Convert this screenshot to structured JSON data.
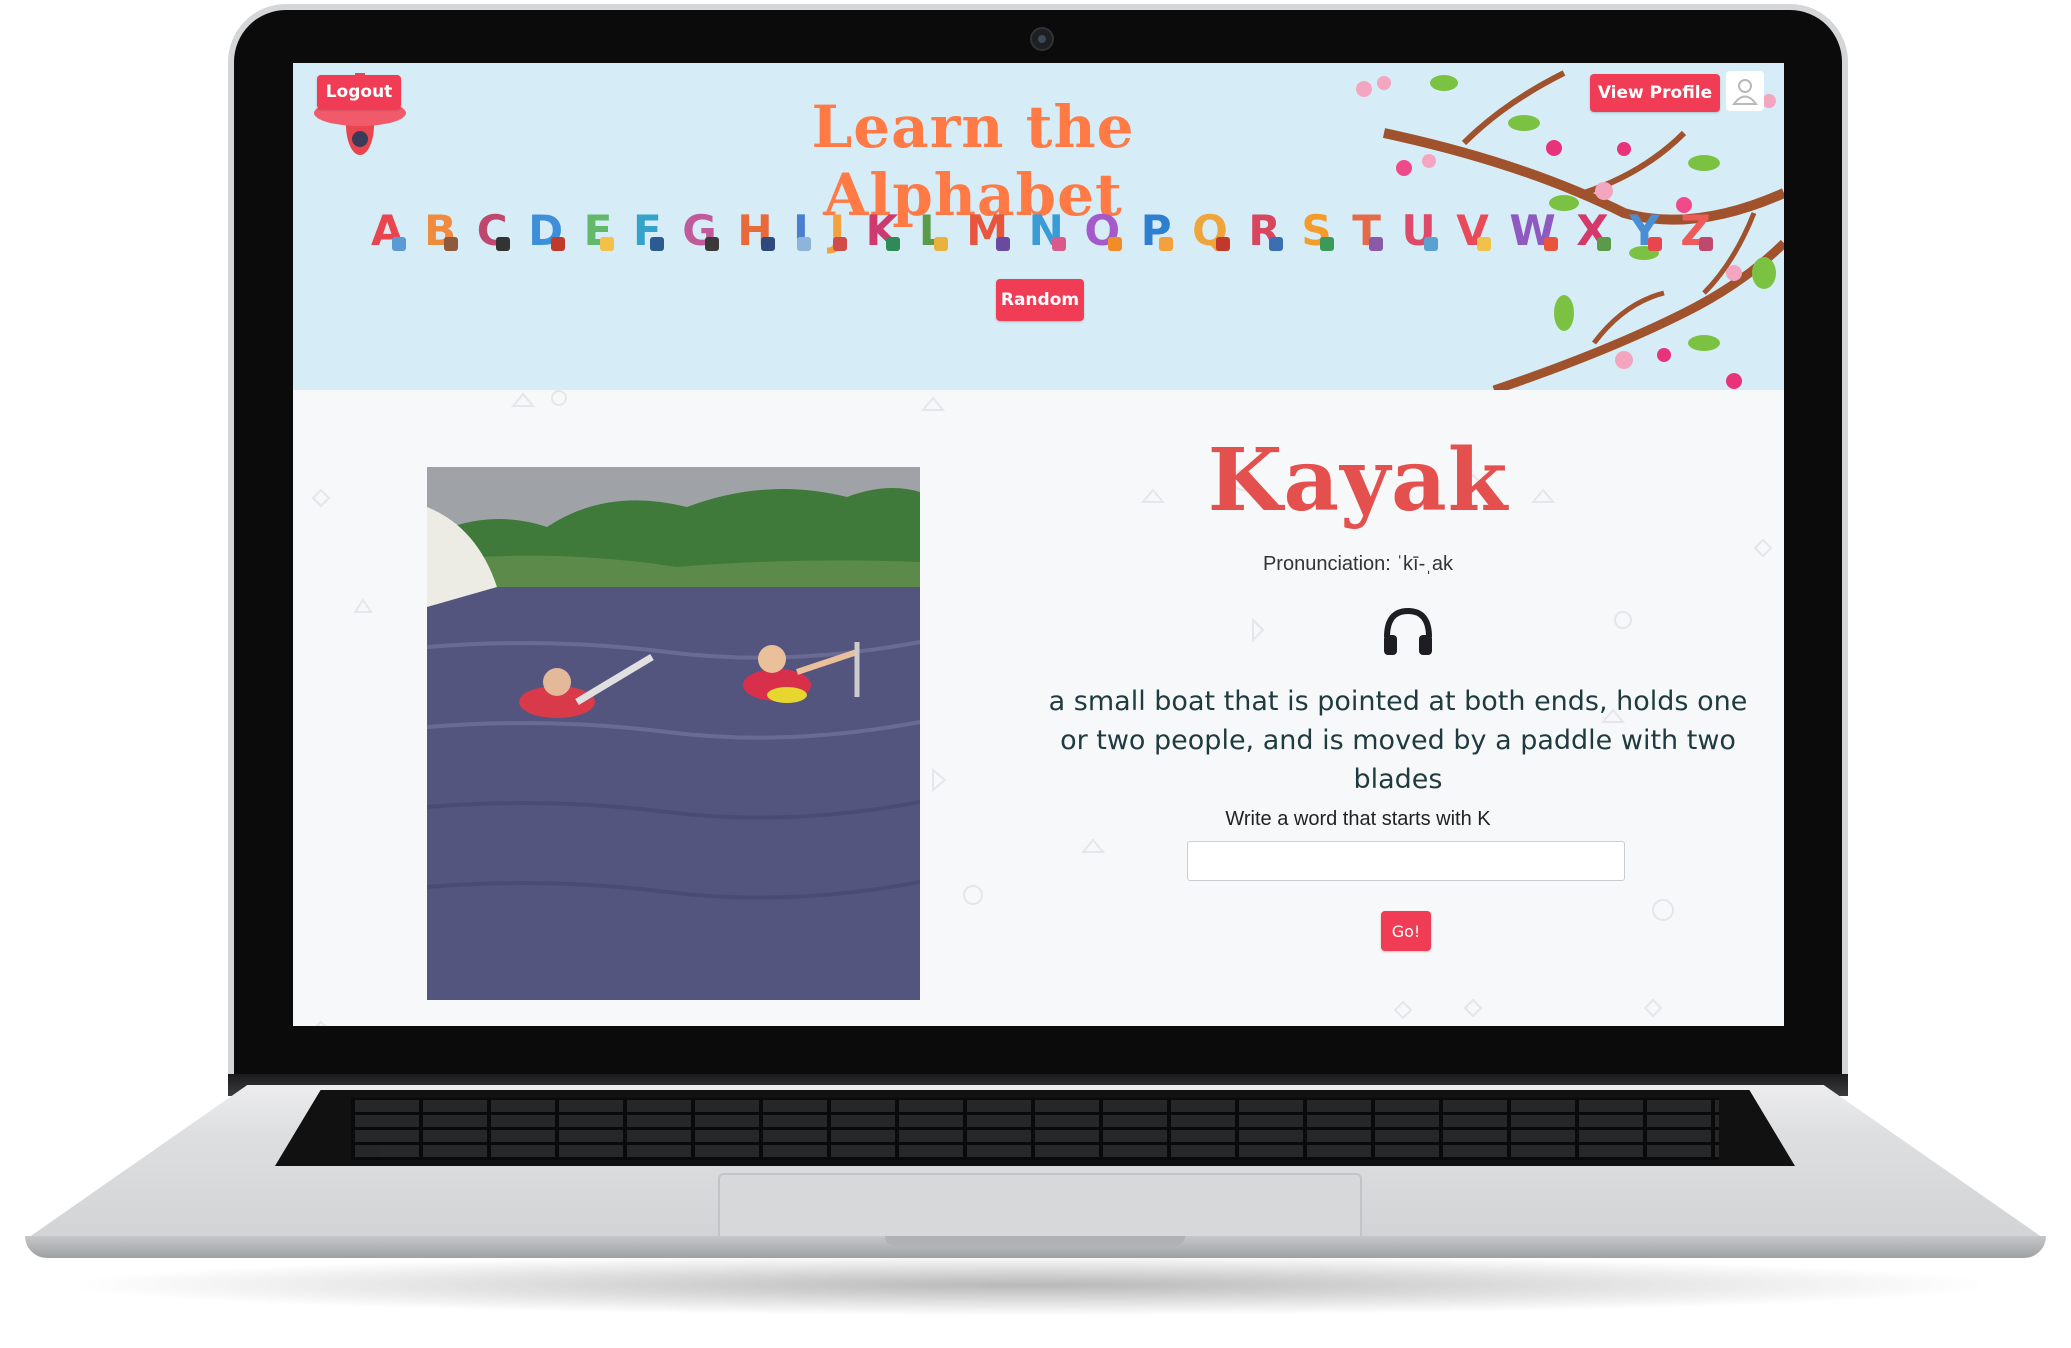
{
  "colors": {
    "accent_button": "#f03c55",
    "header_bg": "#d6edf7",
    "title_orange": "#ff7a45",
    "word_red": "#e4504e"
  },
  "header": {
    "logout_label": "Logout",
    "view_profile_label": "View Profile",
    "title": "Learn the Alphabet",
    "random_label": "Random",
    "avatar_icon": "user-avatar-icon"
  },
  "alphabet": [
    {
      "letter": "A",
      "color": "#e8454e",
      "deco": "#5b9bd5"
    },
    {
      "letter": "B",
      "color": "#f08a3c",
      "deco": "#8e5a3b"
    },
    {
      "letter": "C",
      "color": "#c0486e",
      "deco": "#333333"
    },
    {
      "letter": "D",
      "color": "#3c8fd8",
      "deco": "#c0392b"
    },
    {
      "letter": "E",
      "color": "#62b96a",
      "deco": "#f3c04a"
    },
    {
      "letter": "F",
      "color": "#35a3c9",
      "deco": "#2c5b8f"
    },
    {
      "letter": "G",
      "color": "#c15a9b",
      "deco": "#3a3a3a"
    },
    {
      "letter": "H",
      "color": "#e86a3a",
      "deco": "#2f4a7a"
    },
    {
      "letter": "I",
      "color": "#4a7fd0",
      "deco": "#8fb3d9"
    },
    {
      "letter": "J",
      "color": "#f2a23c",
      "deco": "#d14b4b"
    },
    {
      "letter": "K",
      "color": "#cf3a6e",
      "deco": "#2f8a5a"
    },
    {
      "letter": "L",
      "color": "#5a9a4a",
      "deco": "#e8b23c"
    },
    {
      "letter": "M",
      "color": "#e6553c",
      "deco": "#6a4aa0"
    },
    {
      "letter": "N",
      "color": "#3a9bd6",
      "deco": "#d95a8a"
    },
    {
      "letter": "O",
      "color": "#a45ac8",
      "deco": "#f28c28"
    },
    {
      "letter": "P",
      "color": "#2f7fd0",
      "deco": "#f4a03c"
    },
    {
      "letter": "Q",
      "color": "#f0a53c",
      "deco": "#c0392b"
    },
    {
      "letter": "R",
      "color": "#d8455e",
      "deco": "#3b6fb0"
    },
    {
      "letter": "S",
      "color": "#f39c2c",
      "deco": "#3a9a5a"
    },
    {
      "letter": "T",
      "color": "#e56a4a",
      "deco": "#8a5aa8"
    },
    {
      "letter": "U",
      "color": "#dd4a6a",
      "deco": "#5aa0d0"
    },
    {
      "letter": "V",
      "color": "#e84a5a",
      "deco": "#f2c14a"
    },
    {
      "letter": "W",
      "color": "#8e5ac0",
      "deco": "#e6553c"
    },
    {
      "letter": "X",
      "color": "#d33a6a",
      "deco": "#5a9a4a"
    },
    {
      "letter": "Y",
      "color": "#4a8fd6",
      "deco": "#e8454e"
    },
    {
      "letter": "Z",
      "color": "#ee5a5a",
      "deco": "#c0486e"
    }
  ],
  "main": {
    "word": "Kayak",
    "pronunciation": "Pronunciation: ˈkī-ˌak",
    "audio_icon": "headphones-icon",
    "definition": "a small boat that is pointed at both ends, holds one or two people, and is moved by a paddle with two blades",
    "prompt": "Write a word that starts with K",
    "input_value": "",
    "input_placeholder": "",
    "go_label": "Go!"
  }
}
